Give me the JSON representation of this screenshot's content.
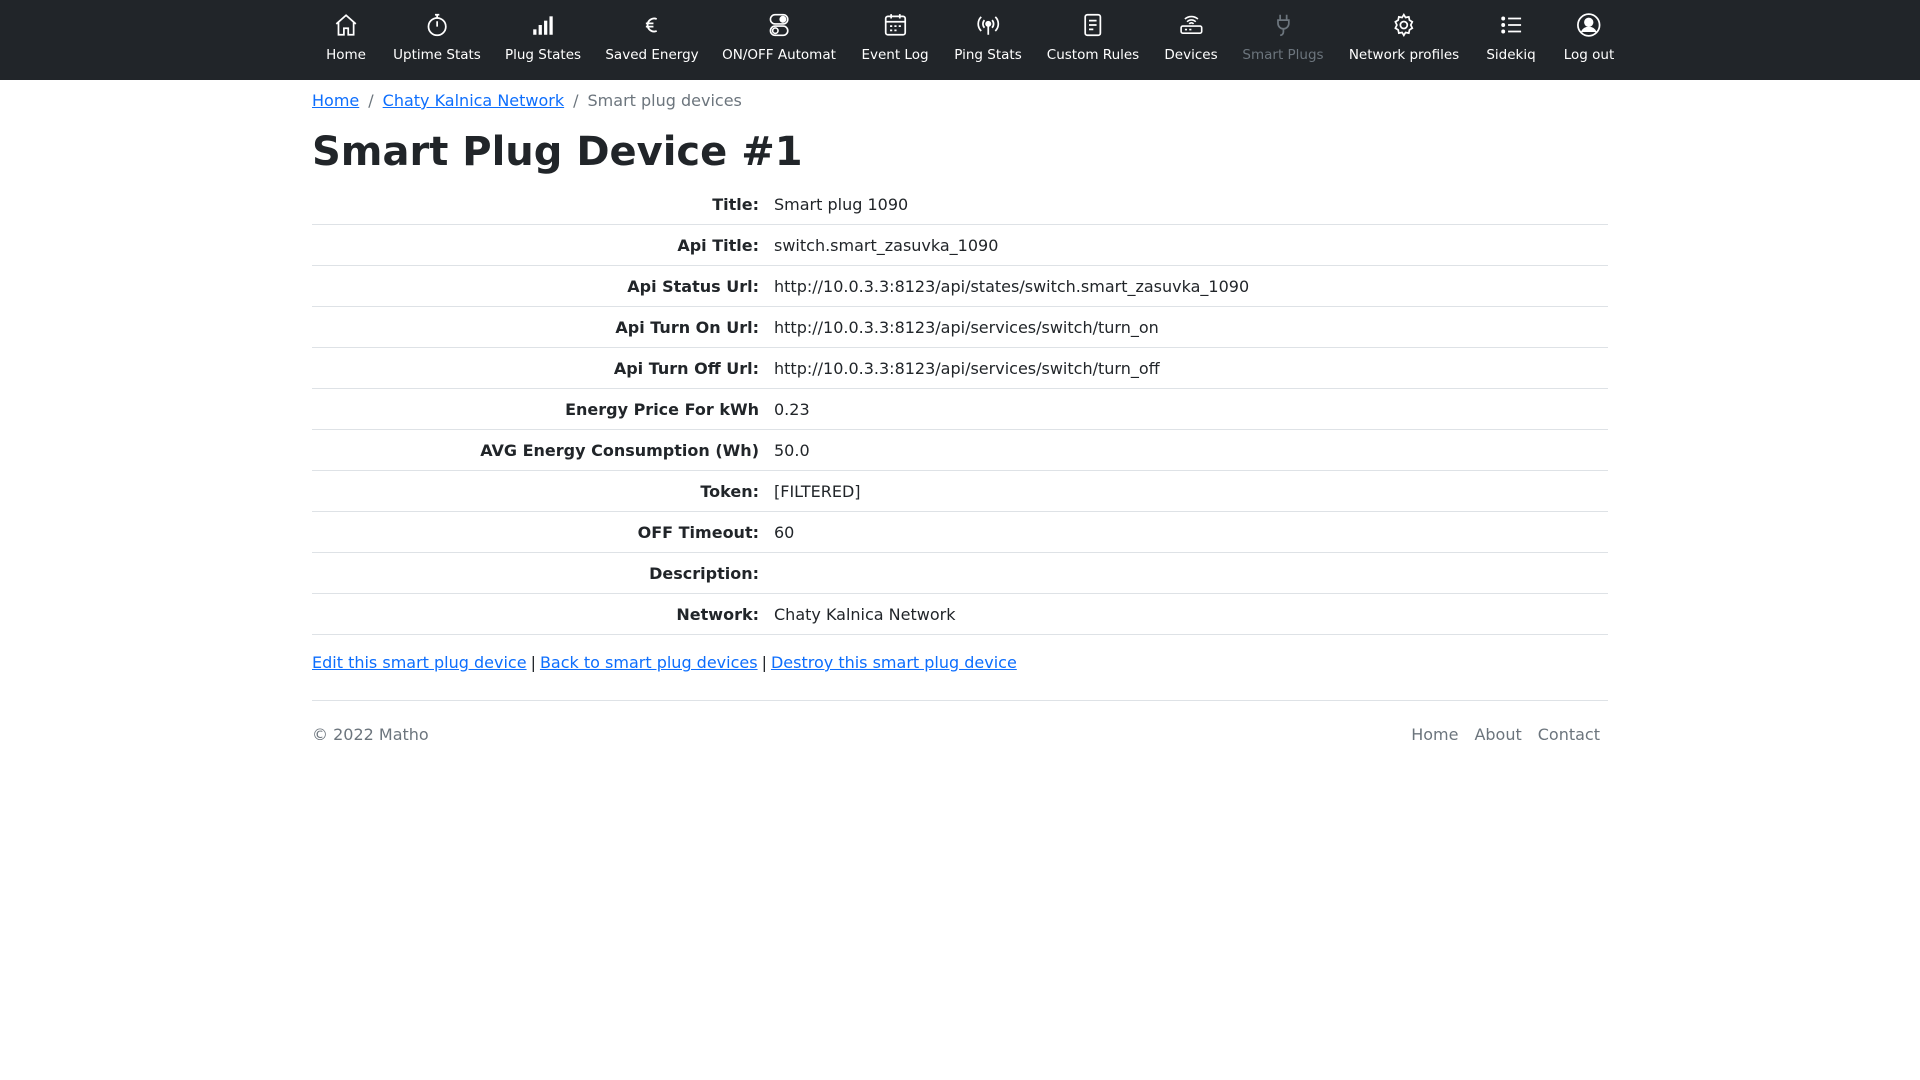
{
  "nav": {
    "items": [
      {
        "label": "Home",
        "icon": "home-icon"
      },
      {
        "label": "Uptime Stats",
        "icon": "stopwatch-icon"
      },
      {
        "label": "Plug States",
        "icon": "signal-bars-icon"
      },
      {
        "label": "Saved Energy",
        "icon": "euro-icon"
      },
      {
        "label": "ON/OFF Automat",
        "icon": "toggles-icon"
      },
      {
        "label": "Event Log",
        "icon": "calendar-icon"
      },
      {
        "label": "Ping Stats",
        "icon": "broadcast-icon"
      },
      {
        "label": "Custom Rules",
        "icon": "document-icon"
      },
      {
        "label": "Devices",
        "icon": "router-icon"
      },
      {
        "label": "Smart Plugs",
        "icon": "plug-icon"
      },
      {
        "label": "Network profiles",
        "icon": "gear-icon"
      },
      {
        "label": "Sidekiq",
        "icon": "list-icon"
      },
      {
        "label": "Log out",
        "icon": "user-circle-icon"
      }
    ]
  },
  "breadcrumb": {
    "home": "Home",
    "network": "Chaty Kalnica Network",
    "current": "Smart plug devices"
  },
  "page": {
    "title": "Smart Plug Device #1"
  },
  "details": [
    {
      "label": "Title:",
      "value": "Smart plug 1090"
    },
    {
      "label": "Api Title:",
      "value": "switch.smart_zasuvka_1090"
    },
    {
      "label": "Api Status Url:",
      "value": "http://10.0.3.3:8123/api/states/switch.smart_zasuvka_1090"
    },
    {
      "label": "Api Turn On Url:",
      "value": "http://10.0.3.3:8123/api/services/switch/turn_on"
    },
    {
      "label": "Api Turn Off Url:",
      "value": "http://10.0.3.3:8123/api/services/switch/turn_off"
    },
    {
      "label": "Energy Price For kWh",
      "value": "0.23"
    },
    {
      "label": "AVG Energy Consumption (Wh)",
      "value": "50.0"
    },
    {
      "label": "Token:",
      "value": "[FILTERED]"
    },
    {
      "label": "OFF Timeout:",
      "value": "60"
    },
    {
      "label": "Description:",
      "value": ""
    },
    {
      "label": "Network:",
      "value": "Chaty Kalnica Network"
    }
  ],
  "actions": {
    "edit": "Edit this smart plug device",
    "separator": "|",
    "back": "Back to smart plug devices",
    "destroy": "Destroy this smart plug device"
  },
  "footer": {
    "copyright": "© 2022 Matho",
    "links": [
      "Home",
      "About",
      "Contact"
    ]
  },
  "colors": {
    "navbar_bg": "#212529",
    "link": "#0d6efd",
    "muted": "#6c757d"
  }
}
